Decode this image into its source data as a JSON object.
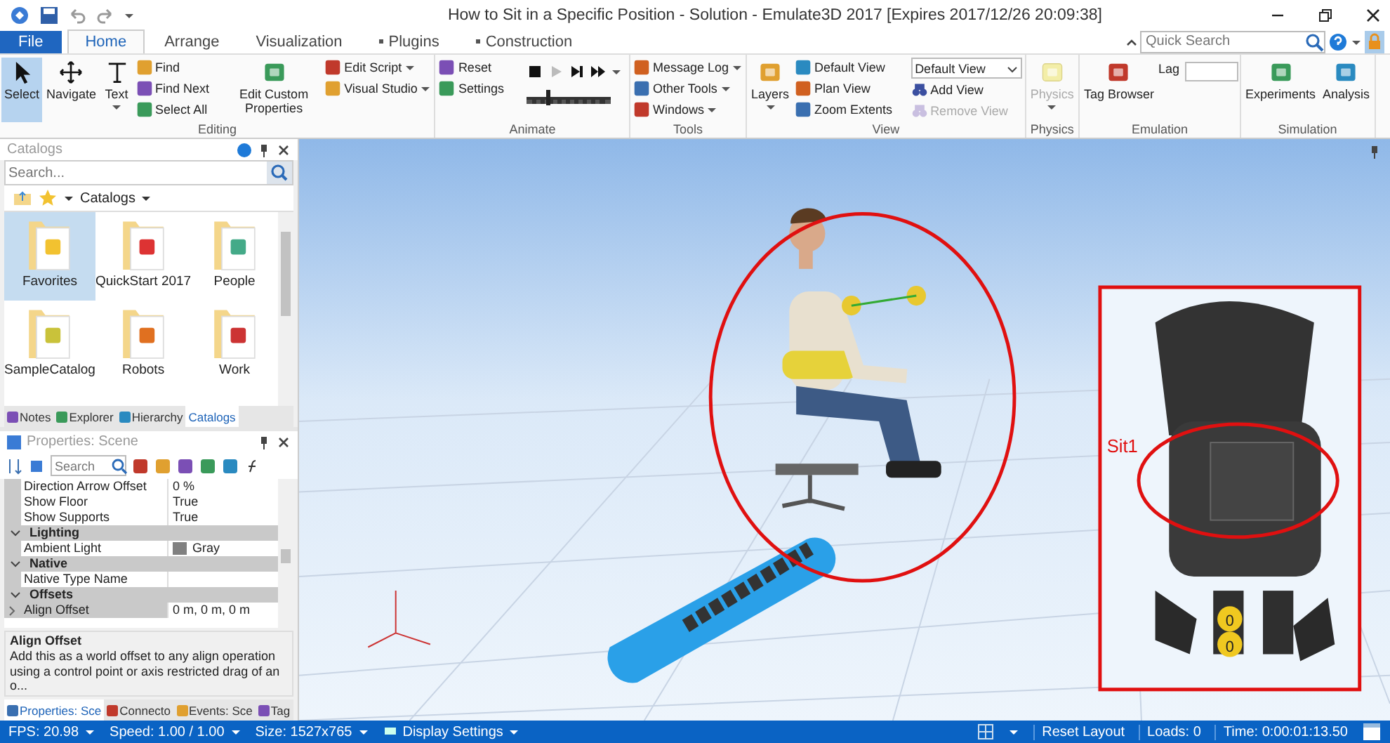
{
  "window": {
    "title": "How to Sit in a Specific Position - Solution - Emulate3D 2017 [Expires 2017/12/26 20:09:38]"
  },
  "ribbon_tabs": [
    {
      "label": "File",
      "kind": "file",
      "selected": false
    },
    {
      "label": "Home",
      "kind": "tab",
      "selected": true
    },
    {
      "label": "Arrange",
      "kind": "tab",
      "selected": false
    },
    {
      "label": "Visualization",
      "kind": "tab",
      "selected": false
    },
    {
      "label": "Plugins",
      "kind": "dotted",
      "selected": false
    },
    {
      "label": "Construction",
      "kind": "dotted",
      "selected": false
    }
  ],
  "quick_search": {
    "placeholder": "Quick Search"
  },
  "ribbon_groups": [
    {
      "label": "Editing",
      "items": [
        {
          "kind": "large",
          "label": "Select",
          "selected": true,
          "dropdown": false,
          "disabled": false
        },
        {
          "kind": "large",
          "label": "Navigate",
          "selected": false,
          "dropdown": false,
          "disabled": false
        },
        {
          "kind": "large",
          "label": "Text",
          "selected": false,
          "dropdown": true,
          "disabled": false
        },
        {
          "kind": "column",
          "items": [
            {
              "label": "Find",
              "dropdown": false,
              "disabled": false
            },
            {
              "label": "Find Next",
              "dropdown": false,
              "disabled": false
            },
            {
              "label": "Select All",
              "dropdown": false,
              "disabled": false
            }
          ]
        },
        {
          "kind": "large",
          "label": "Edit Custom Properties",
          "selected": false,
          "dropdown": false,
          "disabled": false
        },
        {
          "kind": "column",
          "items": [
            {
              "label": "Edit Script",
              "dropdown": true,
              "disabled": false
            },
            {
              "label": "Visual Studio",
              "dropdown": true,
              "disabled": false
            }
          ]
        }
      ]
    },
    {
      "label": "Animate",
      "items": [
        {
          "kind": "column",
          "items": [
            {
              "label": "Reset",
              "dropdown": false,
              "disabled": false
            },
            {
              "label": "Settings",
              "dropdown": false,
              "disabled": false
            }
          ]
        },
        {
          "kind": "player",
          "level": 0.25
        }
      ]
    },
    {
      "label": "Tools",
      "items": [
        {
          "kind": "column",
          "items": [
            {
              "label": "Message Log",
              "dropdown": true,
              "disabled": false
            },
            {
              "label": "Other Tools",
              "dropdown": true,
              "disabled": false
            },
            {
              "label": "Windows",
              "dropdown": true,
              "disabled": false
            }
          ]
        }
      ]
    },
    {
      "label": "View",
      "items": [
        {
          "kind": "large",
          "label": "Layers",
          "selected": false,
          "dropdown": true,
          "disabled": false
        },
        {
          "kind": "column",
          "items": [
            {
              "label": "Default View",
              "dropdown": false,
              "disabled": false
            },
            {
              "label": "Plan View",
              "dropdown": false,
              "disabled": false
            },
            {
              "label": "Zoom Extents",
              "dropdown": false,
              "disabled": false
            }
          ]
        },
        {
          "kind": "select",
          "value": "Default View",
          "items": [
            {
              "label": "Add View",
              "dropdown": false,
              "disabled": false
            },
            {
              "label": "Remove View",
              "dropdown": false,
              "disabled": true
            }
          ]
        }
      ]
    },
    {
      "label": "Physics",
      "items": [
        {
          "kind": "large",
          "label": "Physics",
          "selected": false,
          "dropdown": true,
          "disabled": true
        }
      ]
    },
    {
      "label": "Emulation",
      "items": [
        {
          "kind": "large",
          "label": "Tag Browser",
          "selected": false,
          "dropdown": false,
          "disabled": false
        },
        {
          "kind": "field",
          "label": "Lag"
        }
      ]
    },
    {
      "label": "Simulation",
      "items": [
        {
          "kind": "large",
          "label": "Experiments",
          "selected": false,
          "dropdown": false,
          "disabled": false
        },
        {
          "kind": "large",
          "label": "Analysis",
          "selected": false,
          "dropdown": false,
          "disabled": false
        }
      ]
    }
  ],
  "catalogs": {
    "title": "Catalogs",
    "search_placeholder": "Search...",
    "breadcrumb": "Catalogs",
    "items": [
      {
        "label": "Favorites",
        "selected": true
      },
      {
        "label": "QuickStart 2017",
        "selected": false
      },
      {
        "label": "People",
        "selected": false
      },
      {
        "label": "SampleCatalog",
        "selected": false
      },
      {
        "label": "Robots",
        "selected": false
      },
      {
        "label": "Work",
        "selected": false
      }
    ],
    "tabs": [
      {
        "label": "Notes",
        "selected": false
      },
      {
        "label": "Explorer",
        "selected": false
      },
      {
        "label": "Hierarchy",
        "selected": false
      },
      {
        "label": "Catalogs",
        "selected": true
      }
    ]
  },
  "properties": {
    "title": "Properties: Scene",
    "search_placeholder": "Search",
    "rows": [
      {
        "kind": "property",
        "name": "Direction Arrow Offset",
        "value": "0 %",
        "expandable": false,
        "selected": false
      },
      {
        "kind": "property",
        "name": "Show Floor",
        "value": "True",
        "expandable": false,
        "selected": false
      },
      {
        "kind": "property",
        "name": "Show Supports",
        "value": "True",
        "expandable": false,
        "selected": false
      },
      {
        "kind": "category",
        "name": "Lighting"
      },
      {
        "kind": "color",
        "name": "Ambient Light",
        "value": "Gray",
        "color": "#808080",
        "expandable": false,
        "selected": false
      },
      {
        "kind": "category",
        "name": "Native"
      },
      {
        "kind": "property",
        "name": "Native Type Name",
        "value": "",
        "expandable": false,
        "selected": false
      },
      {
        "kind": "category",
        "name": "Offsets"
      },
      {
        "kind": "property",
        "name": "Align Offset",
        "value": "0 m, 0 m, 0 m",
        "expandable": true,
        "selected": true
      }
    ],
    "description": {
      "title": "Align Offset",
      "text": "Add this as a world offset to any align operation using a control point or axis restricted drag of an o..."
    },
    "tabs": [
      {
        "label": "Properties: Sce",
        "selected": true
      },
      {
        "label": "Connecto",
        "selected": false
      },
      {
        "label": "Events: Sce",
        "selected": false
      },
      {
        "label": "Tag",
        "selected": false
      }
    ]
  },
  "viewport": {
    "inset_label": "Sit1",
    "markers": [
      "0",
      "0"
    ]
  },
  "status_bar": {
    "left": [
      {
        "label": "FPS: 20.98"
      },
      {
        "label": "Speed: 1.00 / 1.00"
      },
      {
        "label": "Size: 1527x765"
      },
      {
        "label": "Display Settings"
      }
    ],
    "right": [
      "Reset Layout",
      "Loads: 0",
      "Time: 0:00:01:13.50"
    ]
  }
}
